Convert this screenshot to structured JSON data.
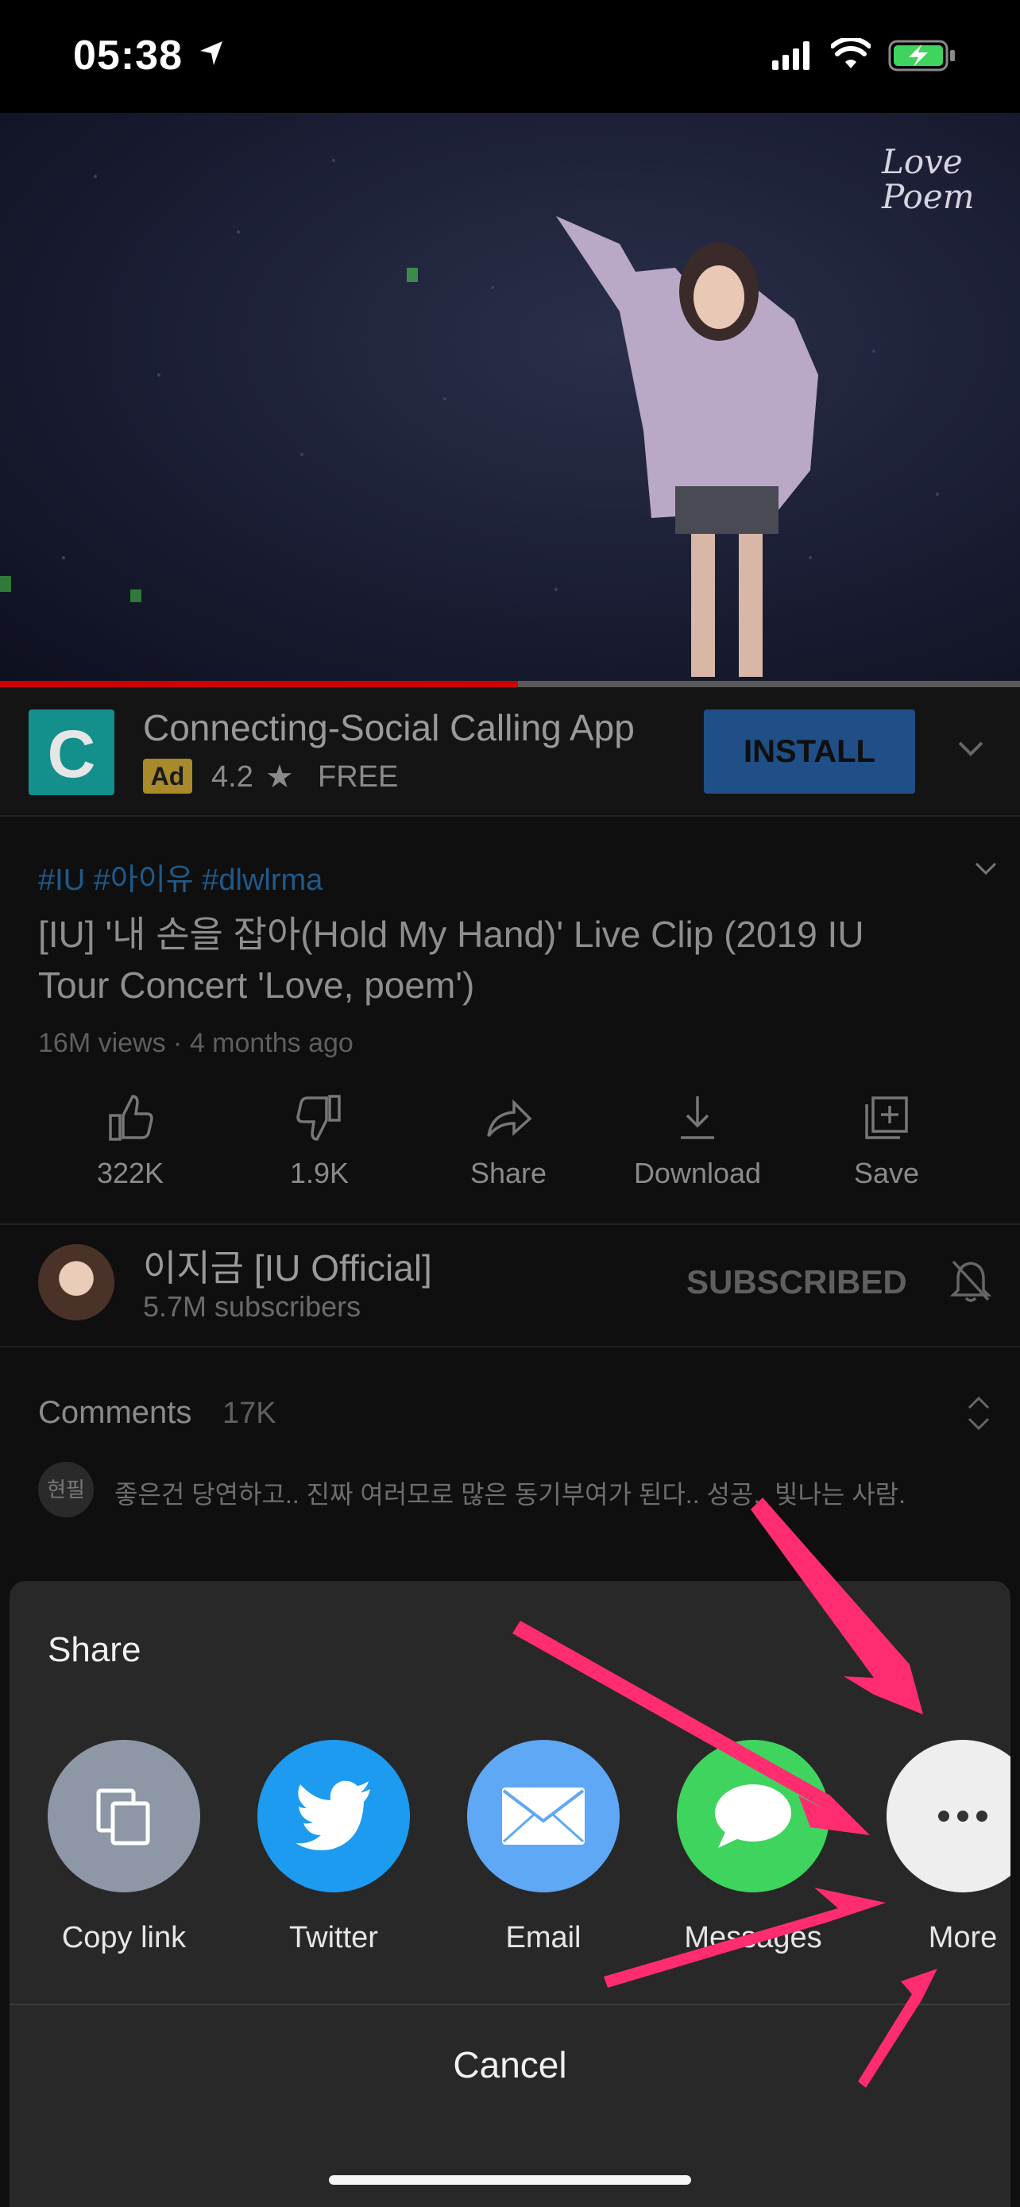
{
  "status_bar": {
    "time": "05:38"
  },
  "video": {
    "watermark": "Love Poem",
    "progress": 0.51
  },
  "ad": {
    "app_name": "Connecting-Social Calling App",
    "badge": "Ad",
    "rating": "4.2",
    "price": "FREE",
    "install_label": "INSTALL",
    "logo_letter": "C"
  },
  "video_info": {
    "hashtags": "#IU #아이유 #dlwlrma",
    "title": "[IU] '내 손을 잡아(Hold My Hand)' Live Clip (2019 IU Tour Concert 'Love, poem')",
    "meta": "16M views · 4 months ago"
  },
  "actions": [
    {
      "label": "322K",
      "icon": "thumbs-up-icon"
    },
    {
      "label": "1.9K",
      "icon": "thumbs-down-icon"
    },
    {
      "label": "Share",
      "icon": "share-icon"
    },
    {
      "label": "Download",
      "icon": "download-icon"
    },
    {
      "label": "Save",
      "icon": "save-icon"
    }
  ],
  "channel": {
    "name": "이지금 [IU Official]",
    "subscribers": "5.7M subscribers",
    "subscribe_label": "SUBSCRIBED"
  },
  "comments": {
    "header": "Comments",
    "count": "17K",
    "avatar_text": "현필",
    "preview": "좋은건 당연하고.. 진짜 여러모로 많은 동기부여가 된다.. 성공.. 빛나는 사람."
  },
  "share_sheet": {
    "title": "Share",
    "options": [
      {
        "label": "Copy link",
        "icon": "copy-link-icon",
        "color": "#8e97a6"
      },
      {
        "label": "Twitter",
        "icon": "twitter-icon",
        "color": "#1d9bf0"
      },
      {
        "label": "Email",
        "icon": "email-icon",
        "color": "#5ea8f5"
      },
      {
        "label": "Messages",
        "icon": "messages-icon",
        "color": "#3fd45e"
      },
      {
        "label": "More",
        "icon": "more-icon",
        "color": "#eeeeee"
      }
    ],
    "cancel_label": "Cancel"
  },
  "colors": {
    "accent_red": "#cc0000",
    "link_blue": "#3ea6ff",
    "arrow_pink": "#ff2d6f"
  }
}
